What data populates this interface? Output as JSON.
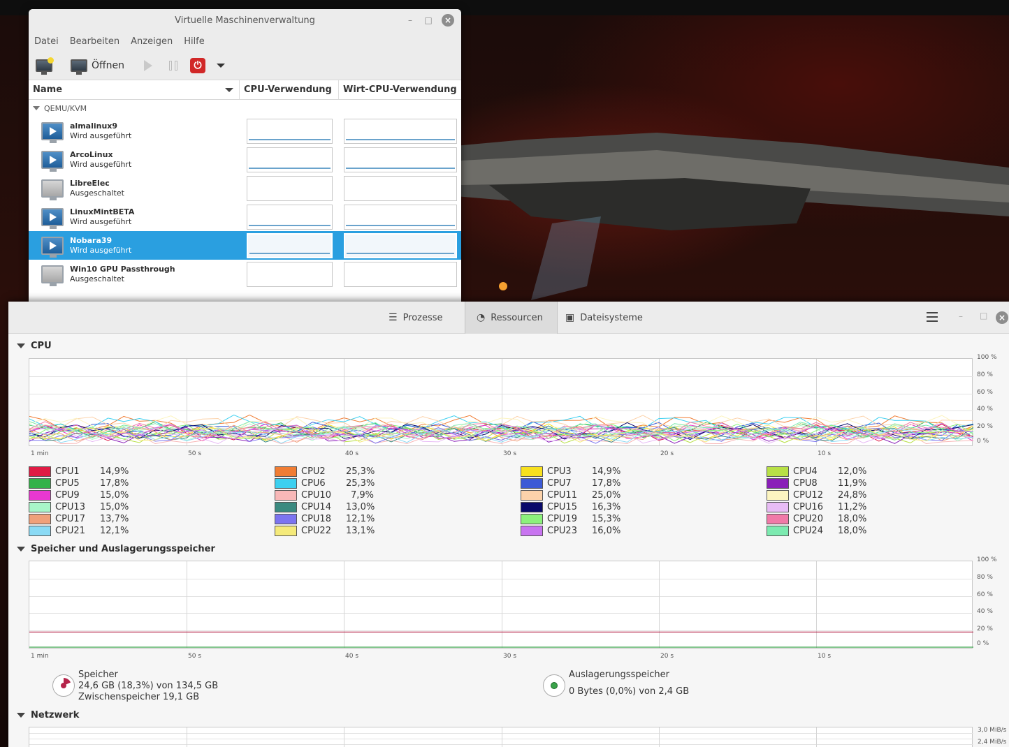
{
  "vm_manager": {
    "title": "Virtuelle Maschinenverwaltung",
    "menu": [
      "Datei",
      "Bearbeiten",
      "Anzeigen",
      "Hilfe"
    ],
    "toolbar": {
      "open_label": "Öffnen"
    },
    "columns": {
      "name": "Name",
      "cpu": "CPU-Verwendung",
      "host_cpu": "Wirt-CPU-Verwendung"
    },
    "group": "QEMU/KVM",
    "vms": [
      {
        "name": "almalinux9",
        "state": "Wird ausgeführt",
        "running": true,
        "selected": false
      },
      {
        "name": "ArcoLinux",
        "state": "Wird ausgeführt",
        "running": true,
        "selected": false
      },
      {
        "name": "LibreElec",
        "state": "Ausgeschaltet",
        "running": false,
        "selected": false
      },
      {
        "name": "LinuxMintBETA",
        "state": "Wird ausgeführt",
        "running": true,
        "selected": false
      },
      {
        "name": "Nobara39",
        "state": "Wird ausgeführt",
        "running": true,
        "selected": true
      },
      {
        "name": "Win10 GPU Passthrough",
        "state": "Ausgeschaltet",
        "running": false,
        "selected": false
      }
    ]
  },
  "system_monitor": {
    "tabs": [
      "Prozesse",
      "Ressourcen",
      "Dateisysteme"
    ],
    "active_tab": "Ressourcen",
    "cpu_section": "CPU",
    "memory_section": "Speicher und Auslagerungsspeicher",
    "network_section": "Netzwerk",
    "y_ticks": [
      "100 %",
      "80 %",
      "60 %",
      "40 %",
      "20 %",
      "0 %"
    ],
    "x_ticks": [
      "1 min",
      "50 s",
      "40 s",
      "30 s",
      "20 s",
      "10 s"
    ],
    "net_y_ticks": [
      "3,0 MiB/s",
      "2,4 MiB/s"
    ],
    "cpus": [
      {
        "name": "CPU1",
        "value": "14,9%",
        "color": "#e01b44"
      },
      {
        "name": "CPU2",
        "value": "25,3%",
        "color": "#f07d34"
      },
      {
        "name": "CPU3",
        "value": "14,9%",
        "color": "#f8e01e"
      },
      {
        "name": "CPU4",
        "value": "12,0%",
        "color": "#b8e046"
      },
      {
        "name": "CPU5",
        "value": "17,8%",
        "color": "#33b24a"
      },
      {
        "name": "CPU6",
        "value": "25,3%",
        "color": "#3dd0f0"
      },
      {
        "name": "CPU7",
        "value": "17,8%",
        "color": "#3c5ad6"
      },
      {
        "name": "CPU8",
        "value": "11,9%",
        "color": "#8a1fb8"
      },
      {
        "name": "CPU9",
        "value": "15,0%",
        "color": "#e838d0"
      },
      {
        "name": "CPU10",
        "value": "7,9%",
        "color": "#f8b8b8"
      },
      {
        "name": "CPU11",
        "value": "25,0%",
        "color": "#fcd2aa"
      },
      {
        "name": "CPU12",
        "value": "24,8%",
        "color": "#fcf4c0"
      },
      {
        "name": "CPU13",
        "value": "15,0%",
        "color": "#a8f5c8"
      },
      {
        "name": "CPU14",
        "value": "13,0%",
        "color": "#3a8a80"
      },
      {
        "name": "CPU15",
        "value": "16,3%",
        "color": "#0a0a6a"
      },
      {
        "name": "CPU16",
        "value": "11,2%",
        "color": "#e8bcf5"
      },
      {
        "name": "CPU17",
        "value": "13,7%",
        "color": "#f0a07a"
      },
      {
        "name": "CPU18",
        "value": "12,1%",
        "color": "#7c74f0"
      },
      {
        "name": "CPU19",
        "value": "15,3%",
        "color": "#8cf27c"
      },
      {
        "name": "CPU20",
        "value": "18,0%",
        "color": "#f07aa8"
      },
      {
        "name": "CPU21",
        "value": "12,1%",
        "color": "#8adaf5"
      },
      {
        "name": "CPU22",
        "value": "13,1%",
        "color": "#f5ea7a"
      },
      {
        "name": "CPU23",
        "value": "16,0%",
        "color": "#c874f0"
      },
      {
        "name": "CPU24",
        "value": "18,0%",
        "color": "#7ceab0"
      }
    ],
    "memory": {
      "label": "Speicher",
      "usage": "24,6 GB (18,3%) von 134,5 GB",
      "cache": "Zwischenspeicher 19,1 GB",
      "fraction": 0.183,
      "color": "#b5244a"
    },
    "swap": {
      "label": "Auslagerungsspeicher",
      "usage": "0 Bytes (0,0%) von 2,4 GB",
      "fraction": 0.0,
      "color": "#3aa34a"
    }
  }
}
